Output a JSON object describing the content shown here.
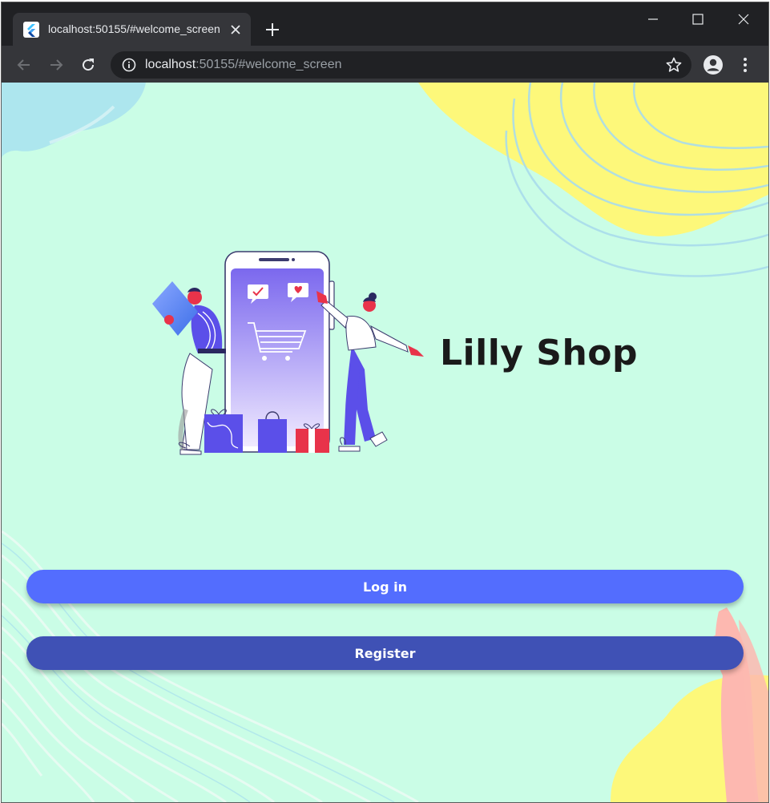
{
  "browser": {
    "tab_title": "localhost:50155/#welcome_screen",
    "url_host": "localhost",
    "url_rest": ":50155/#welcome_screen",
    "icons": {
      "favicon": "flutter-icon",
      "tab_close": "close-icon",
      "new_tab": "plus-icon",
      "minimize": "minimize-icon",
      "maximize": "maximize-icon",
      "close_window": "close-icon",
      "back": "back-arrow-icon",
      "forward": "forward-arrow-icon",
      "reload": "reload-icon",
      "site_info": "info-icon",
      "bookmark": "star-icon",
      "profile": "profile-icon",
      "menu": "kebab-menu-icon"
    }
  },
  "welcome": {
    "app_title": "Lilly Shop",
    "login_label": "Log in",
    "register_label": "Register"
  },
  "colors": {
    "page_background": "#cafde6",
    "login_button": "#536dfe",
    "register_button": "#3f51b5",
    "title_text": "#1a1a1a",
    "accent_yellow": "#fdf87a",
    "accent_blue": "#9ad9ee",
    "accent_pink": "#fdb8b0"
  }
}
